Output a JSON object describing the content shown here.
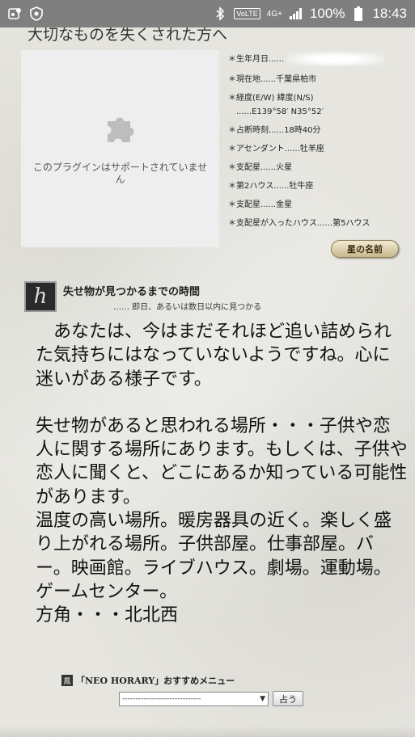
{
  "status_bar": {
    "battery": "100%",
    "time": "18:43",
    "network": "4G+",
    "volte": "VoLTE"
  },
  "top_heading": "大切なものを失くされた方へ",
  "plugin": {
    "message": "このプラグインはサポートされていません"
  },
  "info": {
    "birthdate_label": "＊生年月日......",
    "location": "＊現在地......千葉県柏市",
    "coords_label": "＊経度(E/W) 緯度(N/S)",
    "coords_value": "......E139°58′ N35°52′",
    "time": "＊占断時刻......18時40分",
    "ascendant": "＊アセンダント......牡羊座",
    "ruler": "＊支配星......火星",
    "second_house": "＊第2ハウス......牡牛座",
    "ruler2": "＊支配星......金星",
    "ruler_house": "＊支配星が入ったハウス......第5ハウス"
  },
  "star_button": "星の名前",
  "section": {
    "icon_letter": "h",
    "title": "失せ物が見つかるまでの時間",
    "subtitle": "…… 即日、あるいは数日以内に見つかる"
  },
  "body": {
    "para1": "あなたは、今はまだそれほど追い詰められた気持ちにはなっていないようですね。心に迷いがある様子です。",
    "para2": "失せ物があると思われる場所・・・子供や恋人に関する場所にあります。もしくは、子供や恋人に聞くと、どこにあるか知っている可能性があります。",
    "para3": "温度の高い場所。暖房器具の近く。楽しく盛り上がれる場所。子供部屋。仕事部屋。バー。映画館。ライブハウス。劇場。運動場。ゲームセンター。",
    "para4": "方角・・・北北西"
  },
  "menu": {
    "title": "「NEO HORARY」おすすめメニュー",
    "select_value": "------------------------------",
    "go_button": "占う"
  }
}
